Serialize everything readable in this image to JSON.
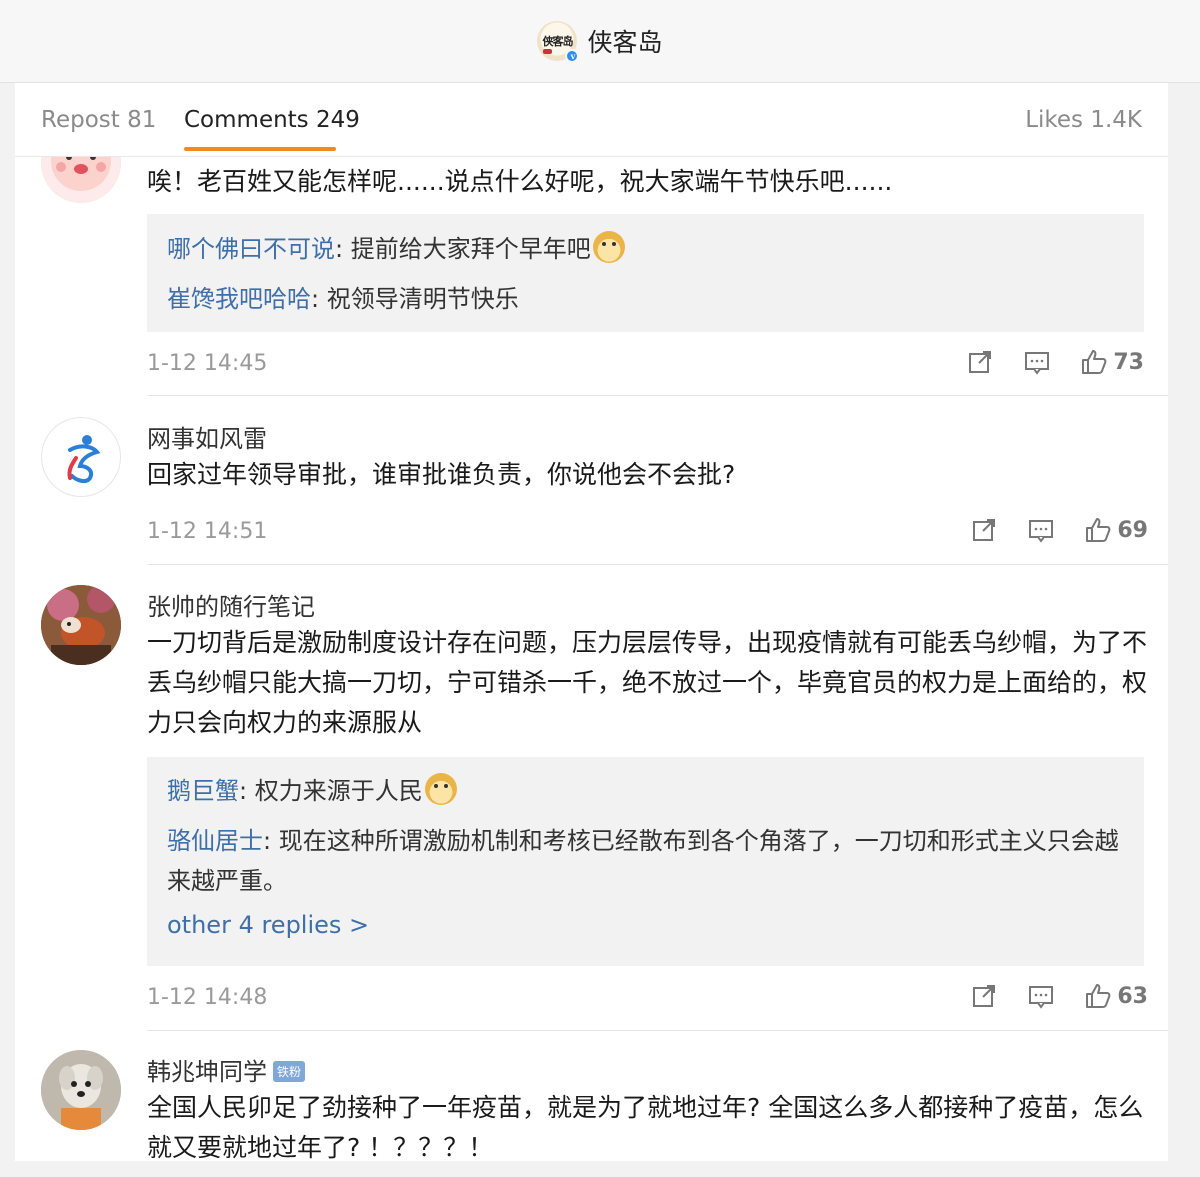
{
  "header": {
    "account_name": "侠客岛",
    "account_logo_text": "侠客岛",
    "verified_mark": "v"
  },
  "tabs": {
    "repost": "Repost 81",
    "comments": "Comments 249",
    "likes": "Likes 1.4K"
  },
  "accent_color": "#f28b1c",
  "link_color": "#3f6fa8",
  "comments": [
    {
      "text": "唉！老百姓又能怎样呢......说点什么好呢，祝大家端午节快乐吧......",
      "replies": [
        {
          "user": "哪个佛曰不可说",
          "text": ": 提前给大家拜个早年吧",
          "emoji": "doge"
        },
        {
          "user": "崔馋我吧哈哈",
          "text": ": 祝领导清明节快乐"
        }
      ],
      "time": "1-12 14:45",
      "likes": "73"
    },
    {
      "user": "网事如风雷",
      "text": "回家过年领导审批，谁审批谁负责，你说他会不会批?",
      "time": "1-12 14:51",
      "likes": "69"
    },
    {
      "user": "张帅的随行笔记",
      "text": "一刀切背后是激励制度设计存在问题，压力层层传导，出现疫情就有可能丢乌纱帽，为了不丢乌纱帽只能大搞一刀切，宁可错杀一千，绝不放过一个，毕竟官员的权力是上面给的，权力只会向权力的来源服从",
      "replies": [
        {
          "user": "鹅巨蟹",
          "text": ": 权力来源于人民",
          "emoji": "doge"
        },
        {
          "user": "骆仙居士",
          "text": ": 现在这种所谓激励机制和考核已经散布到各个角落了，一刀切和形式主义只会越来越严重。"
        }
      ],
      "more_replies": "other 4 replies >",
      "time": "1-12 14:48",
      "likes": "63"
    },
    {
      "user": "韩兆坤同学",
      "badge": "铁粉",
      "text": "全国人民卯足了劲接种了一年疫苗，就是为了就地过年? 全国这么多人都接种了疫苗，怎么就又要就地过年了? ！？？？！"
    }
  ]
}
